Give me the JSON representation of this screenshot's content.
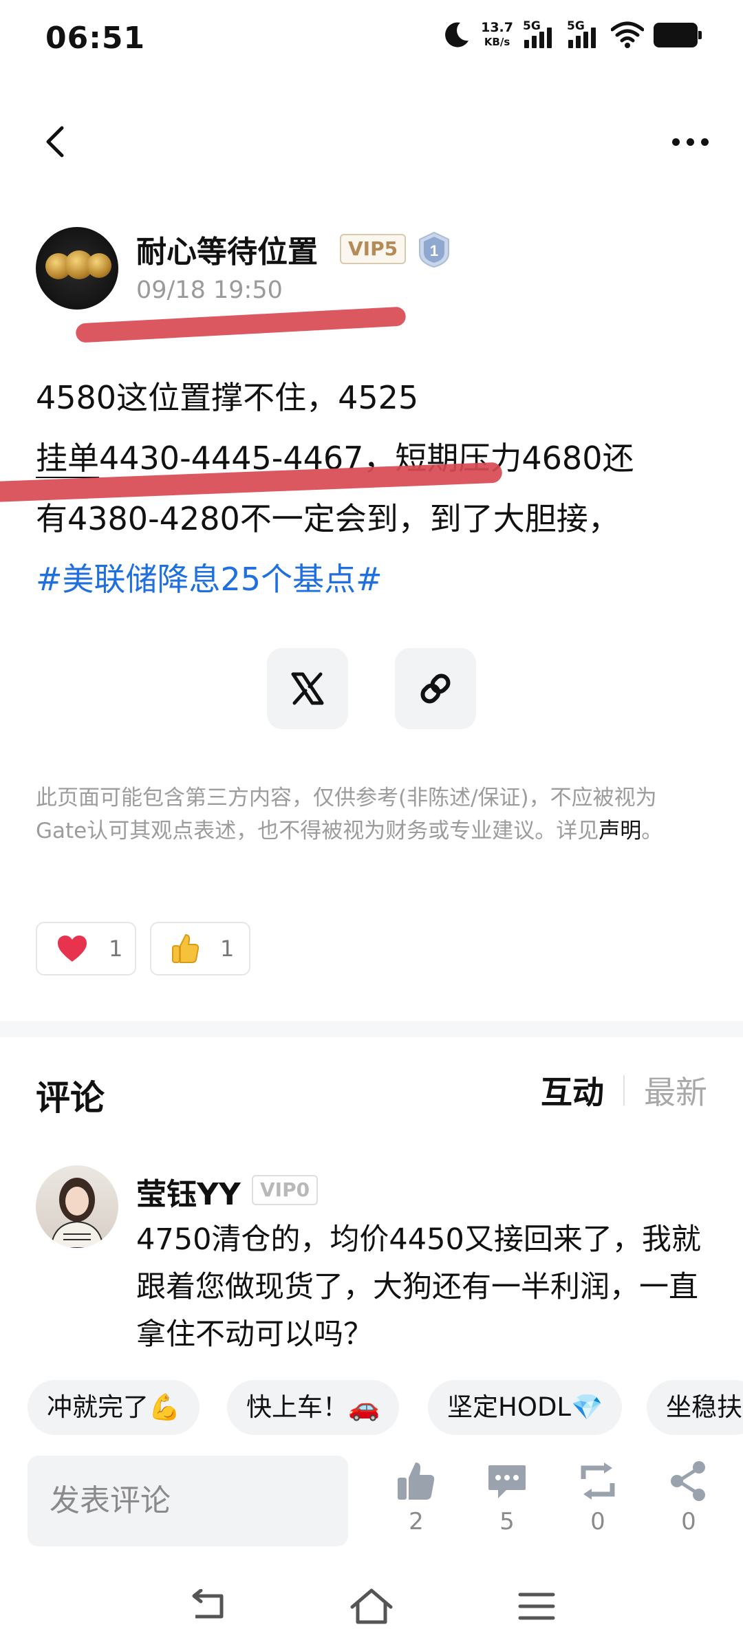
{
  "status_bar": {
    "time": "06:51",
    "net_speed_value": "13.7",
    "net_speed_unit": "KB/s",
    "signal1_label": "5G",
    "signal2_label": "5G",
    "icons": [
      "moon-icon",
      "signal-icon",
      "signal-icon",
      "wifi-icon",
      "battery-icon"
    ]
  },
  "header": {
    "back_icon": "chevron-left-icon",
    "more_icon": "more-dots-icon"
  },
  "post": {
    "author": "耐心等待位置",
    "vip": "VIP5",
    "level_badge": "1",
    "time": "09/18 19:50",
    "line1": "4580这位置撑不住，4525",
    "line2_underlined": "挂单",
    "line2_rest": "4430-4445-4467，短期压力4680还",
    "line3": "有4380-4280不一定会到，到了大胆接，",
    "hashtag": "#美联储降息25个基点#"
  },
  "share": {
    "x_icon": "x-logo-icon",
    "link_icon": "link-icon"
  },
  "disclaimer": {
    "text": "此页面可能包含第三方内容，仅供参考(非陈述/保证)，不应被视为Gate认可其观点表述，也不得被视为财务或专业建议。详见",
    "link": "声明",
    "end": "。"
  },
  "reactions": [
    {
      "icon": "heart-icon",
      "count": "1"
    },
    {
      "icon": "thumbs-up-emoji-icon",
      "count": "1"
    }
  ],
  "comments": {
    "title": "评论",
    "sort_active": "互动",
    "sort_inactive": "最新",
    "items": [
      {
        "name": "莹钰YY",
        "vip": "VIP0",
        "text": "4750清仓的，均价4450又接回来了，我就跟着您做现货了，大狗还有一半利润，一直拿住不动可以吗？"
      }
    ]
  },
  "quick_replies": [
    "冲就完了💪",
    "快上车！🚗",
    "坚定HODL💎",
    "坐稳扶"
  ],
  "bottom_bar": {
    "input_placeholder": "发表评论",
    "like_count": "2",
    "comment_count": "5",
    "repost_count": "0",
    "share_count": "0"
  },
  "colors": {
    "hashtag": "#1f6fde",
    "vip_gold": "#b58a56",
    "marker_red": "#d94a52",
    "heart": "#e8334f"
  }
}
